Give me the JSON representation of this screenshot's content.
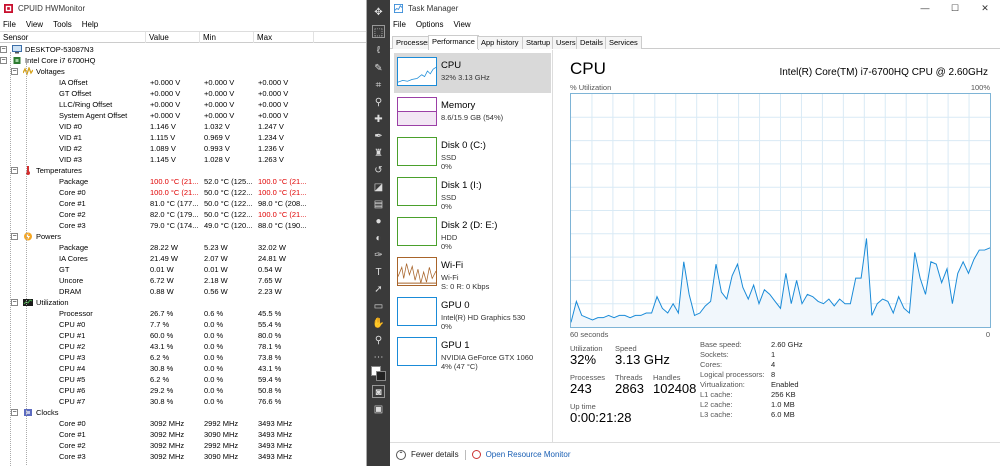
{
  "hwmonitor": {
    "title": "CPUID HWMonitor",
    "menu": [
      "File",
      "View",
      "Tools",
      "Help"
    ],
    "columns": [
      "Sensor",
      "Value",
      "Min",
      "Max"
    ],
    "rows": [
      {
        "d": 0,
        "t": "pc",
        "name": "DESKTOP-53087N3"
      },
      {
        "d": 1,
        "t": "chip",
        "name": "Intel Core i7 6700HQ"
      },
      {
        "d": 2,
        "t": "volt",
        "name": "Voltages"
      },
      {
        "d": 3,
        "name": "IA Offset",
        "v": "+0.000 V",
        "mn": "+0.000 V",
        "mx": "+0.000 V"
      },
      {
        "d": 3,
        "name": "GT Offset",
        "v": "+0.000 V",
        "mn": "+0.000 V",
        "mx": "+0.000 V"
      },
      {
        "d": 3,
        "name": "LLC/Ring Offset",
        "v": "+0.000 V",
        "mn": "+0.000 V",
        "mx": "+0.000 V"
      },
      {
        "d": 3,
        "name": "System Agent Offset",
        "v": "+0.000 V",
        "mn": "+0.000 V",
        "mx": "+0.000 V"
      },
      {
        "d": 3,
        "name": "VID #0",
        "v": "1.146 V",
        "mn": "1.032 V",
        "mx": "1.247 V"
      },
      {
        "d": 3,
        "name": "VID #1",
        "v": "1.115 V",
        "mn": "0.969 V",
        "mx": "1.234 V"
      },
      {
        "d": 3,
        "name": "VID #2",
        "v": "1.089 V",
        "mn": "0.993 V",
        "mx": "1.236 V"
      },
      {
        "d": 3,
        "name": "VID #3",
        "v": "1.145 V",
        "mn": "1.028 V",
        "mx": "1.263 V"
      },
      {
        "d": 2,
        "t": "temp",
        "name": "Temperatures"
      },
      {
        "d": 3,
        "name": "Package",
        "v": "100.0 °C  (21...",
        "mn": "52.0 °C  (125...",
        "mx": "100.0 °C  (21...",
        "rv": true,
        "rx": true
      },
      {
        "d": 3,
        "name": "Core #0",
        "v": "100.0 °C  (21...",
        "mn": "50.0 °C  (122...",
        "mx": "100.0 °C  (21...",
        "rv": true,
        "rx": true
      },
      {
        "d": 3,
        "name": "Core #1",
        "v": "81.0 °C  (177...",
        "mn": "50.0 °C  (122...",
        "mx": "98.0 °C  (208..."
      },
      {
        "d": 3,
        "name": "Core #2",
        "v": "82.0 °C  (179...",
        "mn": "50.0 °C  (122...",
        "mx": "100.0 °C  (21...",
        "rx": true
      },
      {
        "d": 3,
        "name": "Core #3",
        "v": "79.0 °C  (174...",
        "mn": "49.0 °C  (120...",
        "mx": "88.0 °C  (190..."
      },
      {
        "d": 2,
        "t": "power",
        "name": "Powers"
      },
      {
        "d": 3,
        "name": "Package",
        "v": "28.22 W",
        "mn": "5.23 W",
        "mx": "32.02 W"
      },
      {
        "d": 3,
        "name": "IA Cores",
        "v": "21.49 W",
        "mn": "2.07 W",
        "mx": "24.81 W"
      },
      {
        "d": 3,
        "name": "GT",
        "v": "0.01 W",
        "mn": "0.01 W",
        "mx": "0.54 W"
      },
      {
        "d": 3,
        "name": "Uncore",
        "v": "6.72 W",
        "mn": "2.18 W",
        "mx": "7.65 W"
      },
      {
        "d": 3,
        "name": "DRAM",
        "v": "0.88 W",
        "mn": "0.56 W",
        "mx": "2.23 W"
      },
      {
        "d": 2,
        "t": "util",
        "name": "Utilization"
      },
      {
        "d": 3,
        "name": "Processor",
        "v": "26.7 %",
        "mn": "0.6 %",
        "mx": "45.5 %"
      },
      {
        "d": 3,
        "name": "CPU #0",
        "v": "7.7 %",
        "mn": "0.0 %",
        "mx": "55.4 %"
      },
      {
        "d": 3,
        "name": "CPU #1",
        "v": "60.0 %",
        "mn": "0.0 %",
        "mx": "80.0 %"
      },
      {
        "d": 3,
        "name": "CPU #2",
        "v": "43.1 %",
        "mn": "0.0 %",
        "mx": "78.1 %"
      },
      {
        "d": 3,
        "name": "CPU #3",
        "v": "6.2 %",
        "mn": "0.0 %",
        "mx": "73.8 %"
      },
      {
        "d": 3,
        "name": "CPU #4",
        "v": "30.8 %",
        "mn": "0.0 %",
        "mx": "43.1 %"
      },
      {
        "d": 3,
        "name": "CPU #5",
        "v": "6.2 %",
        "mn": "0.0 %",
        "mx": "59.4 %"
      },
      {
        "d": 3,
        "name": "CPU #6",
        "v": "29.2 %",
        "mn": "0.0 %",
        "mx": "50.8 %"
      },
      {
        "d": 3,
        "name": "CPU #7",
        "v": "30.8 %",
        "mn": "0.0 %",
        "mx": "76.6 %"
      },
      {
        "d": 2,
        "t": "clock",
        "name": "Clocks"
      },
      {
        "d": 3,
        "name": "Core #0",
        "v": "3092 MHz",
        "mn": "2992 MHz",
        "mx": "3493 MHz"
      },
      {
        "d": 3,
        "name": "Core #1",
        "v": "3092 MHz",
        "mn": "3090 MHz",
        "mx": "3493 MHz"
      },
      {
        "d": 3,
        "name": "Core #2",
        "v": "3092 MHz",
        "mn": "2992 MHz",
        "mx": "3493 MHz"
      },
      {
        "d": 3,
        "name": "Core #3",
        "v": "3092 MHz",
        "mn": "3090 MHz",
        "mx": "3493 MHz"
      }
    ]
  },
  "taskmanager": {
    "title": "Task Manager",
    "menu": [
      "File",
      "Options",
      "View"
    ],
    "tabs": [
      "Processes",
      "Performance",
      "App history",
      "Startup",
      "Users",
      "Details",
      "Services"
    ],
    "active_tab": 1,
    "side_items": [
      {
        "name": "CPU",
        "l1": "32%  3.13 GHz",
        "l2": "",
        "color": "#1a8bd8",
        "sel": true
      },
      {
        "name": "Memory",
        "l1": "8.6/15.9 GB (54%)",
        "l2": "",
        "color": "#9b3fa6"
      },
      {
        "name": "Disk 0 (C:)",
        "l1": "SSD",
        "l2": "0%",
        "color": "#4aa02c"
      },
      {
        "name": "Disk 1 (I:)",
        "l1": "SSD",
        "l2": "0%",
        "color": "#4aa02c"
      },
      {
        "name": "Disk 2 (D: E:)",
        "l1": "HDD",
        "l2": "0%",
        "color": "#4aa02c"
      },
      {
        "name": "Wi-Fi",
        "l1": "Wi-Fi",
        "l2": "S: 0  R: 0 Kbps",
        "color": "#a8642a"
      },
      {
        "name": "GPU 0",
        "l1": "Intel(R) HD Graphics 530",
        "l2": "0%",
        "color": "#1a8bd8"
      },
      {
        "name": "GPU 1",
        "l1": "NVIDIA GeForce GTX 1060",
        "l2": "4% (47 °C)",
        "color": "#1a8bd8"
      }
    ],
    "cpu": {
      "heading": "CPU",
      "model": "Intel(R) Core(TM) i7-6700HQ CPU @ 2.60GHz",
      "util_label": "% Utilization",
      "max_label": "100%",
      "time_label": "60 seconds",
      "zero_label": "0",
      "utilization_lbl": "Utilization",
      "utilization": "32%",
      "speed_lbl": "Speed",
      "speed": "3.13 GHz",
      "processes_lbl": "Processes",
      "processes": "243",
      "threads_lbl": "Threads",
      "threads": "2863",
      "handles_lbl": "Handles",
      "handles": "102408",
      "uptime_lbl": "Up time",
      "uptime": "0:00:21:28",
      "details": [
        [
          "Base speed:",
          "2.60 GHz"
        ],
        [
          "Sockets:",
          "1"
        ],
        [
          "Cores:",
          "4"
        ],
        [
          "Logical processors:",
          "8"
        ],
        [
          "Virtualization:",
          "Enabled"
        ],
        [
          "L1 cache:",
          "256 KB"
        ],
        [
          "L2 cache:",
          "1.0 MB"
        ],
        [
          "L3 cache:",
          "6.0 MB"
        ]
      ]
    },
    "fewer_details": "Fewer details",
    "open_resmon": "Open Resource Monitor"
  },
  "chart_data": {
    "type": "area",
    "title": "",
    "xlabel": "60 seconds",
    "ylabel": "% Utilization",
    "ylim": [
      0,
      100
    ],
    "values": [
      2,
      11,
      5,
      4,
      3,
      4,
      4,
      5,
      4,
      5,
      5,
      4,
      5,
      5,
      6,
      6,
      13,
      8,
      6,
      10,
      6,
      28,
      14,
      5,
      6,
      9,
      11,
      27,
      15,
      12,
      22,
      27,
      17,
      12,
      18,
      10,
      16,
      14,
      11,
      8,
      23,
      10,
      20,
      10,
      14,
      13,
      11,
      10,
      12,
      9,
      12,
      10,
      10,
      21,
      21,
      38,
      5,
      10,
      12,
      11,
      6,
      13,
      8,
      6,
      32,
      21,
      14,
      28,
      27,
      19,
      25,
      10,
      23,
      28,
      23,
      29,
      33,
      33,
      34
    ]
  }
}
